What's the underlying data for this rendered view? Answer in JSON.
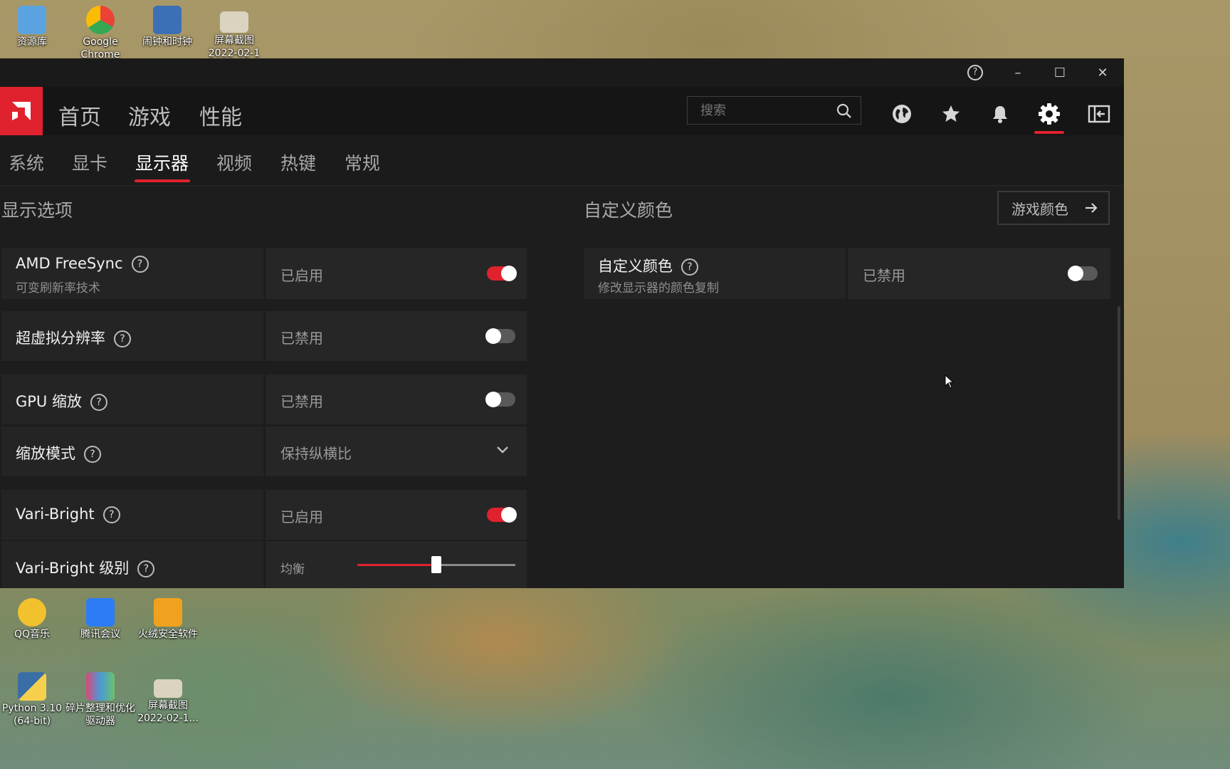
{
  "desktop": {
    "top_icons": [
      {
        "label": "资源库",
        "color": "#5aa3e0"
      },
      {
        "label": "Google Chrome",
        "color": "#e8e8e8"
      },
      {
        "label": "闹钟和时钟",
        "color": "#3b6fb6"
      },
      {
        "label": "屏幕截图 2022-02-1",
        "color": "#d9d3bf"
      }
    ],
    "bottom_icons": [
      {
        "label": "QQ音乐",
        "color": "#f2c12e"
      },
      {
        "label": "腾讯会议",
        "color": "#2d7cf6"
      },
      {
        "label": "火绒安全软件",
        "color": "#f0a21e"
      },
      {
        "label": "Python 3.10 (64-bit)",
        "color": "#3a6ea5"
      },
      {
        "label": "碎片整理和优化驱动器",
        "color": "#d84a7a"
      },
      {
        "label": "屏幕截图 2022-02-1...",
        "color": "#d9d3bf"
      }
    ]
  },
  "window": {
    "title_buttons": {
      "help": "?",
      "minimize": "–",
      "maximize": "☐",
      "close": "✕"
    },
    "main_nav": [
      "首页",
      "游戏",
      "性能"
    ],
    "search_placeholder": "搜索",
    "sub_nav": [
      "系统",
      "显卡",
      "显示器",
      "视频",
      "热键",
      "常规"
    ],
    "active_sub_nav": "显示器",
    "accent": "#e0222e"
  },
  "left_section": {
    "title": "显示选项",
    "rows": [
      {
        "name": "AMD FreeSync",
        "desc": "可变刷新率技术",
        "value": "已启用",
        "toggle": true
      },
      {
        "name": "超虚拟分辨率",
        "value": "已禁用",
        "toggle": false
      },
      {
        "name": "GPU 缩放",
        "value": "已禁用",
        "toggle": false
      },
      {
        "name": "缩放模式",
        "value": "保持纵横比",
        "dropdown": true
      },
      {
        "name": "Vari-Bright",
        "value": "已启用",
        "toggle": true
      },
      {
        "name": "Vari-Bright 级别",
        "value": "均衡",
        "slider_fraction": 0.5
      }
    ]
  },
  "right_section": {
    "title": "自定义颜色",
    "button_label": "游戏颜色",
    "row": {
      "name": "自定义颜色",
      "desc": "修改显示器的颜色复制",
      "value": "已禁用",
      "toggle": false
    }
  }
}
